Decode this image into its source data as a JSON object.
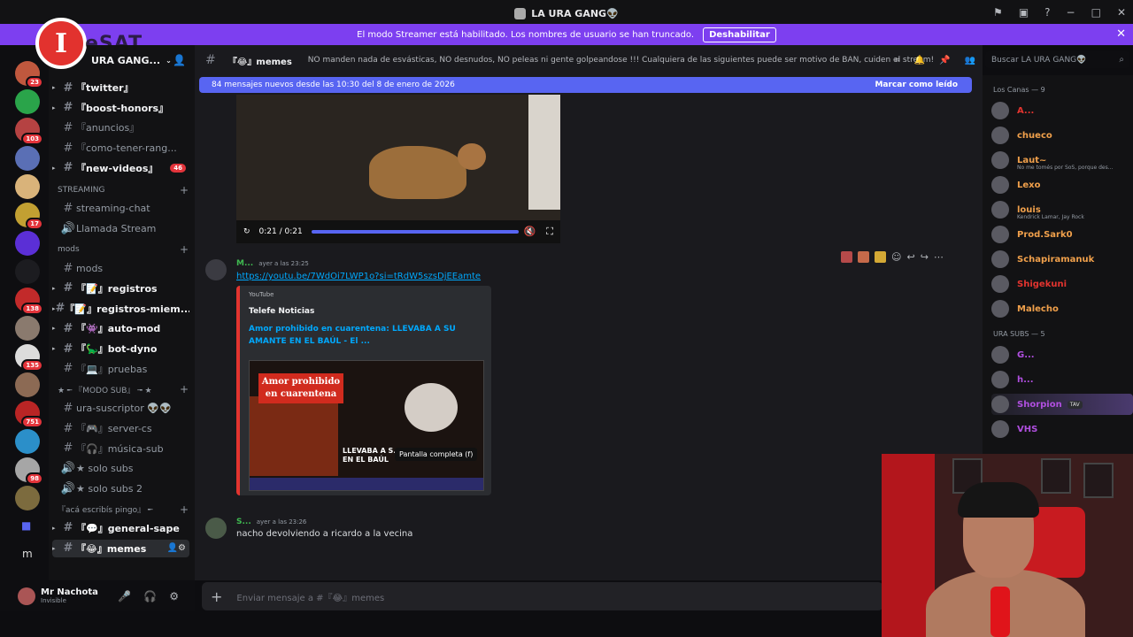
{
  "window": {
    "title": "LA URA GANG👽"
  },
  "streamer_banner": {
    "text": "El modo Streamer está habilitado. Los nombres de usuario se han truncado.",
    "button": "Deshabilitar"
  },
  "server": {
    "name": "URA GANG...",
    "overlay_logo": "I",
    "overlay_text": "eSAT"
  },
  "guild_badges": [
    "23",
    "103",
    "17",
    "138",
    "135",
    "751",
    "98"
  ],
  "channels": [
    {
      "name": "『twitter』",
      "bold": true
    },
    {
      "name": "『boost-honors』",
      "bold": true
    },
    {
      "name": "『anuncios』",
      "bold": false
    },
    {
      "name": "『como-tener-rang...",
      "bold": false
    },
    {
      "name": "『new-videos』",
      "bold": true,
      "count": "46"
    },
    {
      "category": "STREAMING"
    },
    {
      "name": "streaming-chat",
      "bold": false
    },
    {
      "name": "Llamada Stream",
      "bold": false,
      "voice": true
    },
    {
      "category": "mods"
    },
    {
      "name": "mods",
      "bold": false
    },
    {
      "name": "『📝』registros",
      "bold": true
    },
    {
      "name": "『📝』registros-miem...",
      "bold": true
    },
    {
      "name": "『👾』auto-mod",
      "bold": true
    },
    {
      "name": "『🦕』bot-dyno",
      "bold": true
    },
    {
      "name": "『💻』pruebas",
      "bold": false
    },
    {
      "category": "★ ╾ 『MODO SUB』 ╼ ★"
    },
    {
      "name": "ura-suscriptor 👽👽",
      "bold": false
    },
    {
      "name": "『🎮』server-cs",
      "bold": false
    },
    {
      "name": "『🎧』música-sub",
      "bold": false
    },
    {
      "name": "★ solo subs",
      "bold": false,
      "voice": true
    },
    {
      "name": "★ solo subs 2",
      "bold": false,
      "voice": true
    },
    {
      "category": "『acá escribís pingo』 ╾"
    },
    {
      "name": "『💬』general-sape",
      "bold": true
    },
    {
      "name": "『😂』memes",
      "bold": true,
      "active": true
    }
  ],
  "user": {
    "name": "Mr Nachota",
    "status": "Invisible"
  },
  "channel_header": {
    "name": "『😂』memes",
    "topic": "NO manden nada de esvásticas, NO desnudos, NO peleas ni gente golpeandose !!! Cualquiera de las siguientes puede ser motivo de BAN, cuiden el stream!"
  },
  "search": {
    "placeholder": "Buscar LA URA GANG👽"
  },
  "new_messages_bar": {
    "text": "84 mensajes nuevos desde las 10:30 del 8 de enero de 2026",
    "action": "Marcar como leído"
  },
  "video": {
    "time": "0:21 / 0:21"
  },
  "messages": [
    {
      "author": "M...",
      "time": "ayer a las 23:25",
      "text": "https://youtu.be/7WdOi7LWP1o?si=tRdW5szsDjEEamte",
      "embed": {
        "provider": "YouTube",
        "author": "Telefe Noticias",
        "title": "Amor prohibido en cuarentena: LLEVABA A SU AMANTE EN EL BAÚL - El ...",
        "thumb_tag": "Amor prohibido en cuarentena",
        "thumb_caption": "LLEVABA A S... EN EL BAÚL",
        "tooltip": "Pantalla completa (f)"
      }
    },
    {
      "author": "S...",
      "time": "ayer a las 23:26",
      "text": "nacho devolviendo a ricardo a la vecina"
    }
  ],
  "input": {
    "placeholder": "Enviar mensaje a #『😂』memes"
  },
  "member_groups": [
    {
      "title": "Los Canas — 9",
      "members": [
        {
          "name": "A...",
          "color": "#e3342f"
        },
        {
          "name": "chueco",
          "color": "#f0a04b"
        },
        {
          "name": "Laut~",
          "color": "#f0a04b",
          "sub": "No me tomés por SoS, porque des..."
        },
        {
          "name": "Lexo",
          "color": "#f0a04b"
        },
        {
          "name": "louis",
          "color": "#f0a04b",
          "sub": "Kendrick Lamar, Jay Rock"
        },
        {
          "name": "Prod.Sark0",
          "color": "#f0a04b"
        },
        {
          "name": "Schapiramanuk",
          "color": "#f0a04b"
        },
        {
          "name": "Shigekuni",
          "color": "#e3342f"
        },
        {
          "name": "Malecho",
          "color": "#f0a04b"
        }
      ]
    },
    {
      "title": "URA SUBS — 5",
      "members": [
        {
          "name": "G...",
          "color": "#b04fe0"
        },
        {
          "name": "h...",
          "color": "#b04fe0"
        },
        {
          "name": "Shorpion",
          "color": "#b04fe0",
          "tag": "TAV"
        },
        {
          "name": "VHS",
          "color": "#b04fe0"
        }
      ]
    }
  ]
}
